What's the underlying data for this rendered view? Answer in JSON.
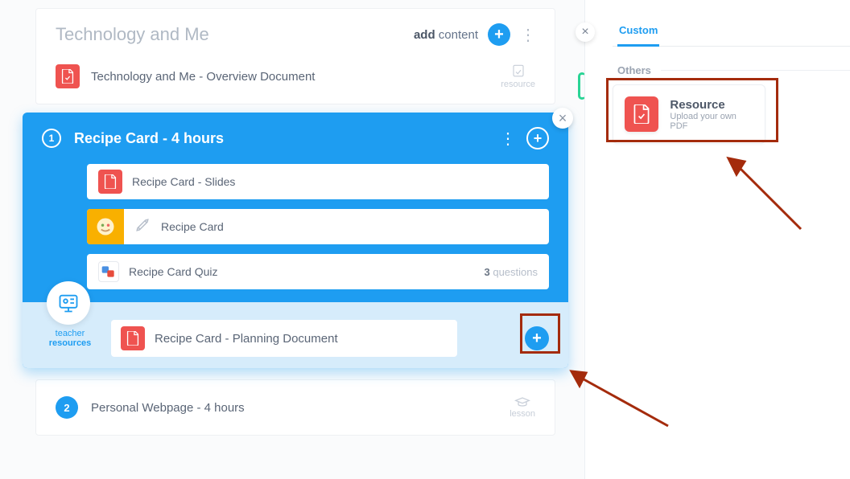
{
  "section": {
    "title": "Technology and Me",
    "add_label_bold": "add",
    "add_label_rest": " content",
    "overview_doc": "Technology and Me - Overview Document",
    "resource_tag": "resource"
  },
  "module": {
    "index": "1",
    "title": "Recipe Card - 4 hours",
    "items": {
      "slides": "Recipe Card - Slides",
      "activity": "Recipe Card",
      "quiz": "Recipe Card Quiz",
      "quiz_count": "3",
      "quiz_unit": " questions"
    },
    "teacher": {
      "label1": "teacher",
      "label2": "resources",
      "doc": "Recipe Card - Planning Document"
    }
  },
  "later": {
    "index": "2",
    "title": "Personal Webpage - 4 hours",
    "lesson_tag": "lesson"
  },
  "panel": {
    "tab_custom": "Custom",
    "section_others": "Others",
    "resource_title": "Resource",
    "resource_sub": "Upload your own PDF"
  },
  "colors": {
    "accent": "#1e9df1",
    "pdf": "#ef5350",
    "highlight": "#a42b0c"
  }
}
